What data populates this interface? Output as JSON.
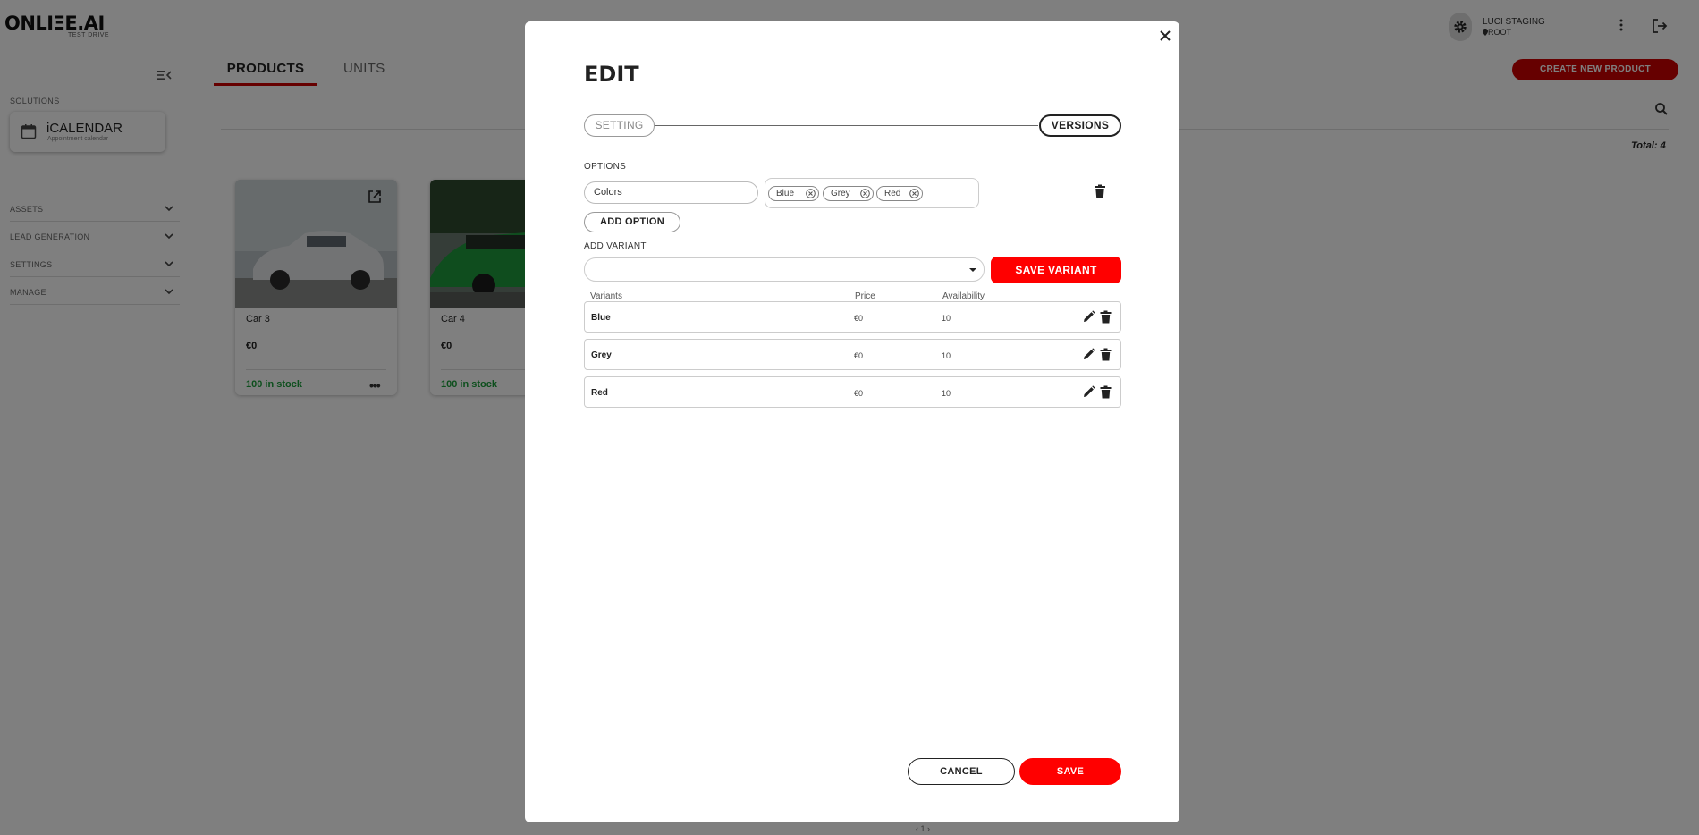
{
  "app": {
    "logo": "ONLIΞE.AI",
    "logo_sub": "TEST DRIVE"
  },
  "header": {
    "user_name": "LUCI STAGING",
    "user_location": "ROOT"
  },
  "sidebar": {
    "section_title": "SOLUTIONS",
    "solution_card": {
      "name": "iCALENDAR",
      "subtitle": "Appointment calendar"
    },
    "groups": [
      {
        "label": "ASSETS"
      },
      {
        "label": "LEAD GENERATION"
      },
      {
        "label": "SETTINGS"
      },
      {
        "label": "MANAGE"
      }
    ]
  },
  "main": {
    "tabs": [
      {
        "label": "PRODUCTS",
        "active": true
      },
      {
        "label": "UNITS",
        "active": false
      }
    ],
    "create_button": "CREATE NEW PRODUCT",
    "total": "Total: 4",
    "products": [
      {
        "name": "Car 3",
        "price": "€0",
        "stock": "100 in stock",
        "color": "silver"
      },
      {
        "name": "Car 4",
        "price": "€0",
        "stock": "100 in stock",
        "color": "green"
      }
    ],
    "pager": "‹   1   ›"
  },
  "modal": {
    "title": "EDIT",
    "steps": [
      {
        "label": "SETTING",
        "active": false
      },
      {
        "label": "VERSIONS",
        "active": true
      }
    ],
    "options_label": "OPTIONS",
    "option": {
      "name": "Colors",
      "values": [
        "Blue",
        "Grey",
        "Red"
      ]
    },
    "add_option_button": "ADD OPTION",
    "add_variant_label": "ADD VARIANT",
    "variant_select_value": "",
    "save_variant_button": "SAVE VARIANT",
    "variant_columns": [
      "Variants",
      "Price",
      "Availability"
    ],
    "variants": [
      {
        "name": "Blue",
        "price": "€0",
        "availability": "10"
      },
      {
        "name": "Grey",
        "price": "€0",
        "availability": "10"
      },
      {
        "name": "Red",
        "price": "€0",
        "availability": "10"
      }
    ],
    "cancel_button": "CANCEL",
    "save_button": "SAVE"
  },
  "colors": {
    "accent_red": "#ff0000",
    "brand_dark_red": "#cc0000",
    "stock_green": "#1a9e3a"
  }
}
